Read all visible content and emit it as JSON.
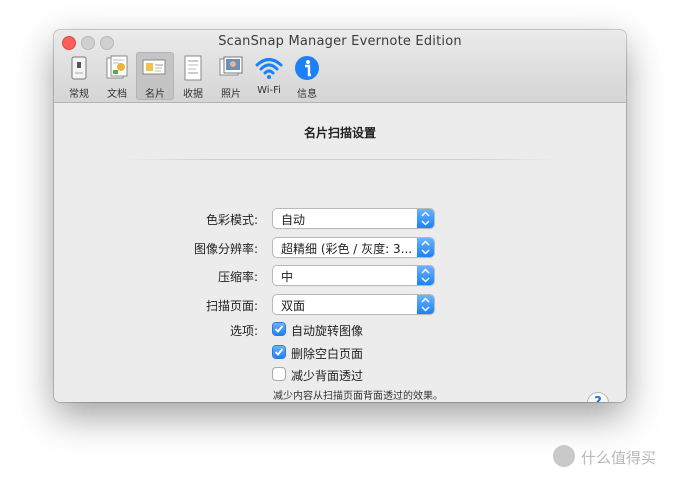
{
  "window": {
    "title": "ScanSnap Manager Evernote Edition"
  },
  "toolbar": {
    "items": [
      {
        "label": "常规",
        "icon": "general-icon"
      },
      {
        "label": "文档",
        "icon": "document-icon"
      },
      {
        "label": "名片",
        "icon": "business-card-icon",
        "active": true
      },
      {
        "label": "收据",
        "icon": "receipt-icon"
      },
      {
        "label": "照片",
        "icon": "photo-icon"
      },
      {
        "label": "Wi-Fi",
        "icon": "wifi-icon"
      },
      {
        "label": "信息",
        "icon": "info-icon"
      }
    ]
  },
  "section": {
    "title": "名片扫描设置"
  },
  "settings": {
    "color_mode": {
      "label": "色彩模式:",
      "value": "自动"
    },
    "resolution": {
      "label": "图像分辨率:",
      "value": "超精细 (彩色 / 灰度: 3..."
    },
    "compression": {
      "label": "压缩率:",
      "value": "中"
    },
    "scan_side": {
      "label": "扫描页面:",
      "value": "双面"
    },
    "options": {
      "label": "选项:",
      "items": [
        {
          "label": "自动旋转图像",
          "checked": true
        },
        {
          "label": "删除空白页面",
          "checked": true
        },
        {
          "label": "减少背面透过",
          "checked": false
        }
      ],
      "hint": "减少内容从扫描页面背面透过的效果。"
    }
  },
  "help": {
    "label": "?"
  },
  "watermark": {
    "text": "什么值得买"
  },
  "colors": {
    "accent": "#1a82f7",
    "close": "#fc605c"
  }
}
